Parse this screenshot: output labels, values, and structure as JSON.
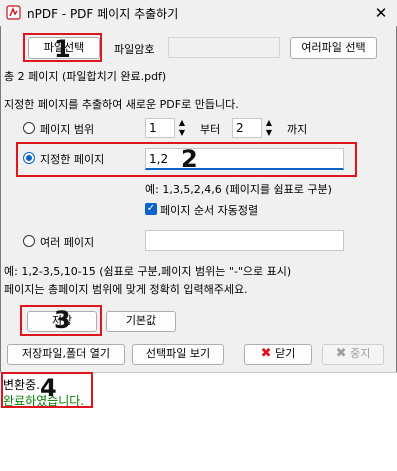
{
  "window": {
    "title": "nPDF - PDF 페이지 추출하기",
    "close_glyph": "✕"
  },
  "top_row": {
    "select_file_label": "파일선택",
    "file_password_label": "파일암호",
    "password_value": "",
    "multi_file_select_label": "여러파일 선택"
  },
  "file_info": "총 2 페이지 (파일합치기 완료.pdf)",
  "description": "지정한 페이지를 추출하여 새로운 PDF로 만듭니다.",
  "page_range": {
    "label": "페이지 범위",
    "from_value": "1",
    "from_text": "부터",
    "to_value": "2",
    "to_text": "까지",
    "selected": false
  },
  "specified_pages": {
    "label": "지정한 페이지",
    "value": "1,2",
    "selected": true,
    "example": "예: 1,3,5,2,4,6 (페이지를 쉼표로 구분)",
    "auto_sort_label": "페이지 순서 자동정렬",
    "auto_sort_checked": true
  },
  "multiple_pages": {
    "label": "여러 페이지",
    "value": "",
    "selected": false,
    "example": "예: 1,2-3,5,10-15 (쉼표로 구분,페이지 범위는 \"-\"으로 표시)",
    "note": "페이지는 총페이지 범위에 맞게 정확히 입력해주세요."
  },
  "action_row": {
    "save_label": "저장",
    "default_label": "기본값"
  },
  "bottom_row": {
    "save_open_folder_label": "저장파일,폴더 열기",
    "view_selected_label": "선택파일 보기",
    "close_label": "닫기",
    "stop_label": "중지"
  },
  "log": {
    "line1": "변환중.",
    "line2": "완료하였습니다.",
    "line2_color": "#008000"
  },
  "annotations": {
    "n1": "1",
    "n2": "2",
    "n3": "3",
    "n4": "4",
    "color": "#e0141e"
  },
  "colors": {
    "accent": "#0a64c8",
    "close_icon": "#e0141e"
  }
}
